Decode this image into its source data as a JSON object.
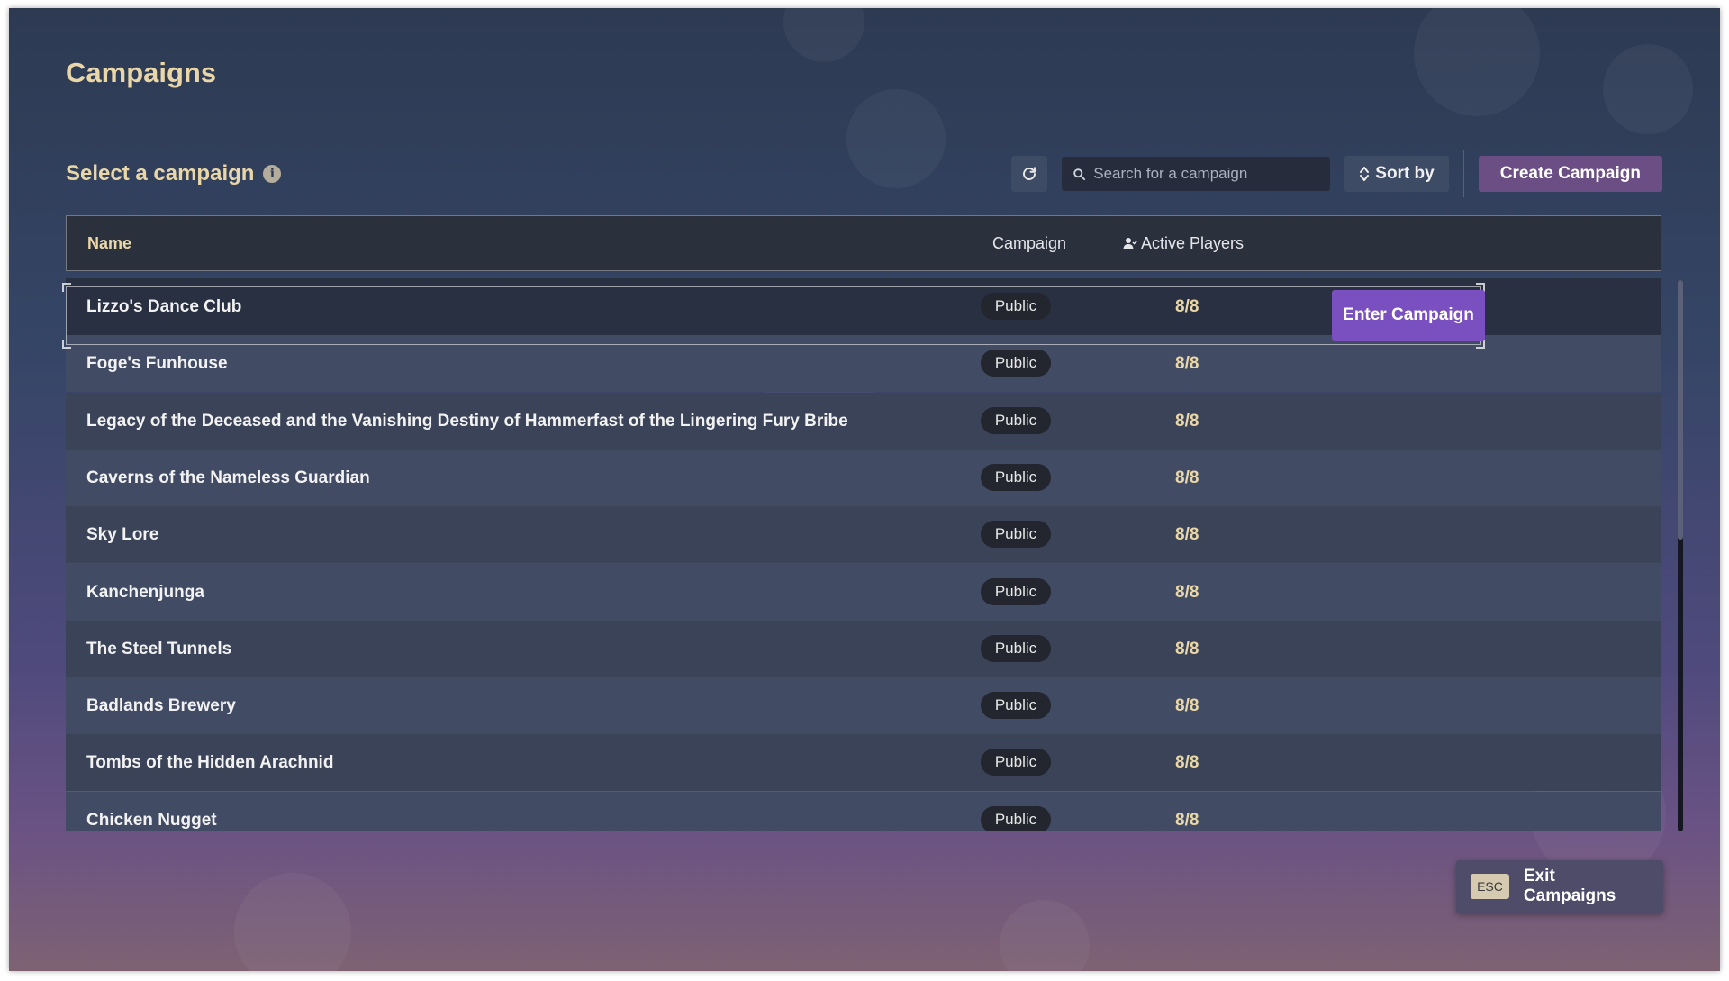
{
  "page": {
    "title": "Campaigns"
  },
  "section": {
    "title": "Select a campaign",
    "info_icon": "info-icon"
  },
  "toolbar": {
    "refresh_icon": "refresh-icon",
    "search_placeholder": "Search for a campaign",
    "search_value": "",
    "sort_label": "Sort by",
    "create_label": "Create Campaign"
  },
  "table": {
    "headers": {
      "name": "Name",
      "campaign": "Campaign",
      "players": "Active Players"
    },
    "rows": [
      {
        "name": "Lizzo's Dance Club",
        "visibility": "Public",
        "players": "8/8"
      },
      {
        "name": "Foge's Funhouse",
        "visibility": "Public",
        "players": "8/8"
      },
      {
        "name": "Legacy of the Deceased and the Vanishing Destiny of Hammerfast of the Lingering Fury Bribe",
        "visibility": "Public",
        "players": "8/8"
      },
      {
        "name": "Caverns of the Nameless Guardian",
        "visibility": "Public",
        "players": "8/8"
      },
      {
        "name": "Sky Lore",
        "visibility": "Public",
        "players": "8/8"
      },
      {
        "name": "Kanchenjunga",
        "visibility": "Public",
        "players": "8/8"
      },
      {
        "name": "The Steel Tunnels",
        "visibility": "Public",
        "players": "8/8"
      },
      {
        "name": "Badlands Brewery",
        "visibility": "Public",
        "players": "8/8"
      },
      {
        "name": "Tombs of the Hidden Arachnid",
        "visibility": "Public",
        "players": "8/8"
      },
      {
        "name": "Chicken Nugget",
        "visibility": "Public",
        "players": "8/8"
      }
    ],
    "selected_index": 0,
    "enter_label": "Enter Campaign"
  },
  "footer": {
    "esc_key": "ESC",
    "exit_label": "Exit Campaigns"
  },
  "colors": {
    "accent_gold": "#ead7a8",
    "primary_purple": "#7a4fc0",
    "create_purple": "#6b4f84"
  }
}
